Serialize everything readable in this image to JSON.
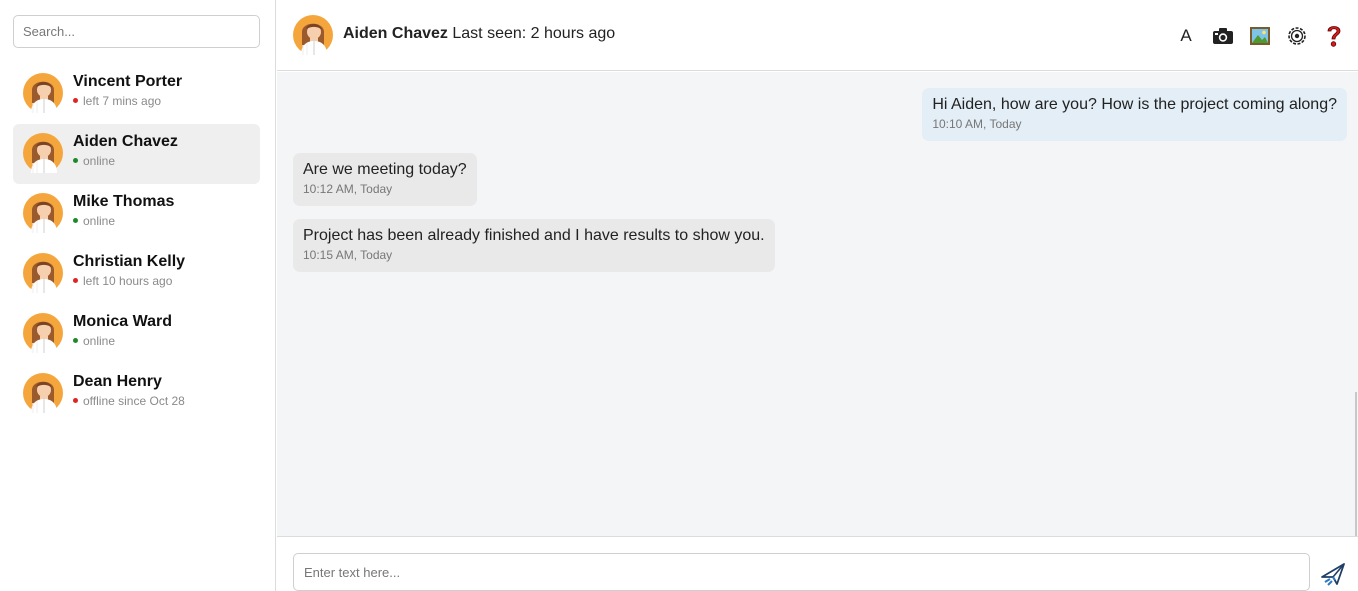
{
  "sidebar": {
    "search_placeholder": "Search...",
    "contacts": [
      {
        "name": "Vincent Porter",
        "status": "left 7 mins ago",
        "status_color": "#e02424",
        "active": false
      },
      {
        "name": "Aiden Chavez",
        "status": "online",
        "status_color": "#1d8a2a",
        "active": true
      },
      {
        "name": "Mike Thomas",
        "status": "online",
        "status_color": "#1d8a2a",
        "active": false
      },
      {
        "name": "Christian Kelly",
        "status": "left 10 hours ago",
        "status_color": "#e02424",
        "active": false
      },
      {
        "name": "Monica Ward",
        "status": "online",
        "status_color": "#1d8a2a",
        "active": false
      },
      {
        "name": "Dean Henry",
        "status": "offline since Oct 28",
        "status_color": "#e02424",
        "active": false
      }
    ]
  },
  "header": {
    "name": "Aiden Chavez",
    "last_seen": "Last seen: 2 hours ago",
    "tools": {
      "font": "A",
      "icons": [
        "camera-icon",
        "image-icon",
        "settings-icon",
        "help-icon"
      ]
    }
  },
  "messages": [
    {
      "direction": "out",
      "text": "Hi Aiden, how are you? How is the project coming along?",
      "time": "10:10 AM, Today"
    },
    {
      "direction": "in",
      "text": "Are we meeting today?",
      "time": "10:12 AM, Today"
    },
    {
      "direction": "in",
      "text": "Project has been already finished and I have results to show you.",
      "time": "10:15 AM, Today"
    }
  ],
  "composer": {
    "placeholder": "Enter text here...",
    "send_icon": "send-icon"
  },
  "colors": {
    "outgoing_bubble": "#e3eef6",
    "incoming_bubble": "#e9e9ea",
    "chat_background": "#f4f5f7",
    "online": "#1d8a2a",
    "offline": "#e02424"
  }
}
